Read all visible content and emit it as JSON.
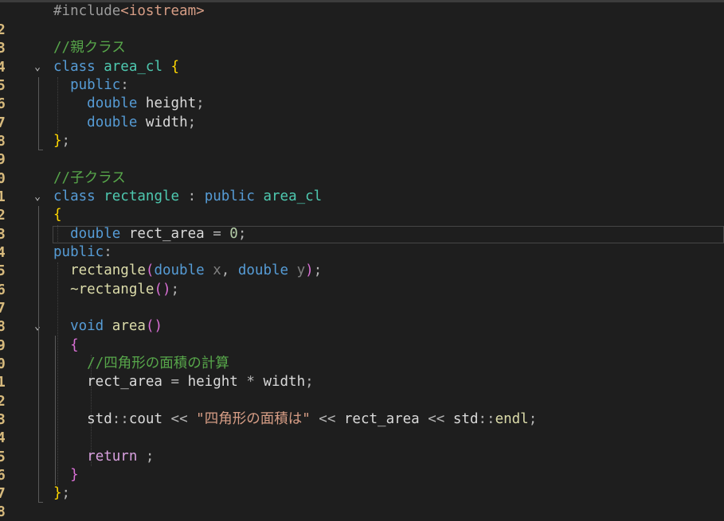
{
  "editor": {
    "line_numbers": [
      "",
      "2",
      "3",
      "4",
      "5",
      "6",
      "7",
      "8",
      "9",
      "0",
      "1",
      "2",
      "3",
      "4",
      "5",
      "6",
      "7",
      "8",
      "9",
      "0",
      "1",
      "2",
      "3",
      "4",
      "5",
      "6",
      "7",
      "8"
    ],
    "code": {
      "l1": [
        {
          "c": "pre",
          "t": "#include"
        },
        {
          "c": "str",
          "t": "<iostream>"
        }
      ],
      "l3": [
        {
          "c": "cmt",
          "t": "//親クラス"
        }
      ],
      "l4": [
        {
          "c": "kw",
          "t": "class"
        },
        {
          "c": "tx",
          "t": " "
        },
        {
          "c": "ty",
          "t": "area_cl"
        },
        {
          "c": "tx",
          "t": " "
        },
        {
          "c": "br1",
          "t": "{"
        }
      ],
      "l5": [
        {
          "c": "tx",
          "t": "  "
        },
        {
          "c": "kw",
          "t": "public"
        },
        {
          "c": "op",
          "t": ":"
        }
      ],
      "l6": [
        {
          "c": "tx",
          "t": "    "
        },
        {
          "c": "kw",
          "t": "double"
        },
        {
          "c": "tx",
          "t": " "
        },
        {
          "c": "tx",
          "t": "height"
        },
        {
          "c": "op",
          "t": ";"
        }
      ],
      "l7": [
        {
          "c": "tx",
          "t": "    "
        },
        {
          "c": "kw",
          "t": "double"
        },
        {
          "c": "tx",
          "t": " "
        },
        {
          "c": "tx",
          "t": "width"
        },
        {
          "c": "op",
          "t": ";"
        }
      ],
      "l8": [
        {
          "c": "br1",
          "t": "}"
        },
        {
          "c": "op",
          "t": ";"
        }
      ],
      "l10": [
        {
          "c": "cmt",
          "t": "//子クラス"
        }
      ],
      "l11": [
        {
          "c": "kw",
          "t": "class"
        },
        {
          "c": "tx",
          "t": " "
        },
        {
          "c": "ty",
          "t": "rectangle"
        },
        {
          "c": "tx",
          "t": " "
        },
        {
          "c": "op",
          "t": ":"
        },
        {
          "c": "tx",
          "t": " "
        },
        {
          "c": "kw",
          "t": "public"
        },
        {
          "c": "tx",
          "t": " "
        },
        {
          "c": "ty",
          "t": "area_cl"
        }
      ],
      "l12": [
        {
          "c": "br1",
          "t": "{"
        }
      ],
      "l13": [
        {
          "c": "tx",
          "t": "  "
        },
        {
          "c": "kw",
          "t": "double"
        },
        {
          "c": "tx",
          "t": " rect_area "
        },
        {
          "c": "op",
          "t": "="
        },
        {
          "c": "tx",
          "t": " "
        },
        {
          "c": "num",
          "t": "0"
        },
        {
          "c": "op",
          "t": ";"
        }
      ],
      "l14": [
        {
          "c": "kw",
          "t": "public"
        },
        {
          "c": "op",
          "t": ":"
        }
      ],
      "l15": [
        {
          "c": "tx",
          "t": "  "
        },
        {
          "c": "fn",
          "t": "rectangle"
        },
        {
          "c": "br2",
          "t": "("
        },
        {
          "c": "kw",
          "t": "double"
        },
        {
          "c": "tx",
          "t": " "
        },
        {
          "c": "dim",
          "t": "x"
        },
        {
          "c": "op",
          "t": ","
        },
        {
          "c": "tx",
          "t": " "
        },
        {
          "c": "kw",
          "t": "double"
        },
        {
          "c": "tx",
          "t": " "
        },
        {
          "c": "dim",
          "t": "y"
        },
        {
          "c": "br2",
          "t": ")"
        },
        {
          "c": "op",
          "t": ";"
        }
      ],
      "l16": [
        {
          "c": "tx",
          "t": "  "
        },
        {
          "c": "fn",
          "t": "~rectangle"
        },
        {
          "c": "br2",
          "t": "()"
        },
        {
          "c": "op",
          "t": ";"
        }
      ],
      "l18": [
        {
          "c": "tx",
          "t": "  "
        },
        {
          "c": "kw",
          "t": "void"
        },
        {
          "c": "tx",
          "t": " "
        },
        {
          "c": "fn",
          "t": "area"
        },
        {
          "c": "br2",
          "t": "()"
        }
      ],
      "l19": [
        {
          "c": "tx",
          "t": "  "
        },
        {
          "c": "br2",
          "t": "{"
        }
      ],
      "l20": [
        {
          "c": "tx",
          "t": "    "
        },
        {
          "c": "cmt",
          "t": "//四角形の面積の計算"
        }
      ],
      "l21": [
        {
          "c": "tx",
          "t": "    rect_area "
        },
        {
          "c": "op",
          "t": "="
        },
        {
          "c": "tx",
          "t": " height "
        },
        {
          "c": "op",
          "t": "*"
        },
        {
          "c": "tx",
          "t": " width"
        },
        {
          "c": "op",
          "t": ";"
        }
      ],
      "l23": [
        {
          "c": "tx",
          "t": "    std"
        },
        {
          "c": "op",
          "t": "::"
        },
        {
          "c": "tx",
          "t": "cout "
        },
        {
          "c": "op",
          "t": "<<"
        },
        {
          "c": "tx",
          "t": " "
        },
        {
          "c": "str",
          "t": "\"四角形の面積は\""
        },
        {
          "c": "tx",
          "t": " "
        },
        {
          "c": "op",
          "t": "<<"
        },
        {
          "c": "tx",
          "t": " rect_area "
        },
        {
          "c": "op",
          "t": "<<"
        },
        {
          "c": "tx",
          "t": " std"
        },
        {
          "c": "op",
          "t": "::"
        },
        {
          "c": "fn",
          "t": "endl"
        },
        {
          "c": "op",
          "t": ";"
        }
      ],
      "l25": [
        {
          "c": "tx",
          "t": "    "
        },
        {
          "c": "ret",
          "t": "return"
        },
        {
          "c": "tx",
          "t": " "
        },
        {
          "c": "op",
          "t": ";"
        }
      ],
      "l26": [
        {
          "c": "tx",
          "t": "  "
        },
        {
          "c": "br2",
          "t": "}"
        }
      ],
      "l27": [
        {
          "c": "br1",
          "t": "}"
        },
        {
          "c": "op",
          "t": ";"
        }
      ]
    }
  }
}
